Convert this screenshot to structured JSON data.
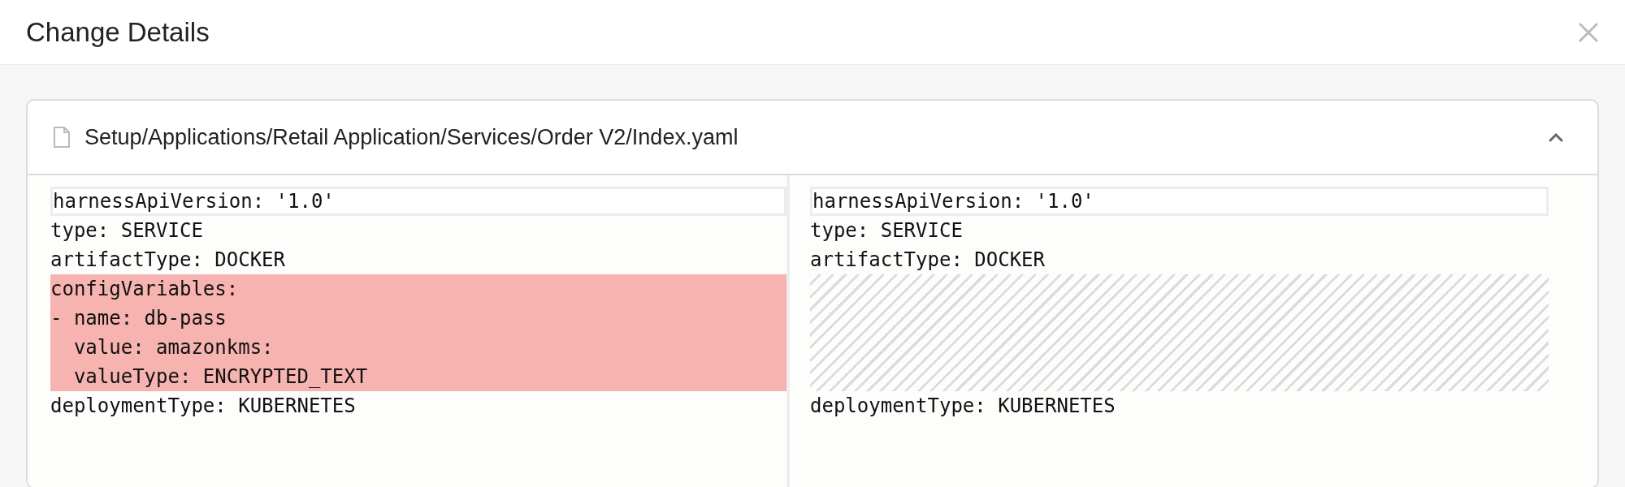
{
  "dialog": {
    "title": "Change Details"
  },
  "file": {
    "path": "Setup/Applications/Retail Application/Services/Order V2/Index.yaml",
    "expanded": true
  },
  "diff": {
    "left": [
      {
        "text": "harnessApiVersion: '1.0'",
        "kind": "context",
        "selected": true
      },
      {
        "text": "type: SERVICE",
        "kind": "context",
        "selected": false
      },
      {
        "text": "artifactType: DOCKER",
        "kind": "context",
        "selected": false
      },
      {
        "text": "configVariables:",
        "kind": "removed",
        "selected": false
      },
      {
        "text": "- name: db-pass",
        "kind": "removed",
        "selected": false
      },
      {
        "text": "  value: amazonkms:",
        "kind": "removed",
        "selected": false
      },
      {
        "text": "  valueType: ENCRYPTED_TEXT",
        "kind": "removed",
        "selected": false
      },
      {
        "text": "deploymentType: KUBERNETES",
        "kind": "context",
        "selected": false
      }
    ],
    "right": [
      {
        "text": "harnessApiVersion: '1.0'",
        "kind": "context",
        "selected": true
      },
      {
        "text": "type: SERVICE",
        "kind": "context",
        "selected": false
      },
      {
        "text": "artifactType: DOCKER",
        "kind": "context",
        "selected": false
      },
      {
        "kind": "filler"
      },
      {
        "kind": "filler"
      },
      {
        "kind": "filler"
      },
      {
        "kind": "filler"
      },
      {
        "text": "deploymentType: KUBERNETES",
        "kind": "context",
        "selected": false
      }
    ]
  }
}
